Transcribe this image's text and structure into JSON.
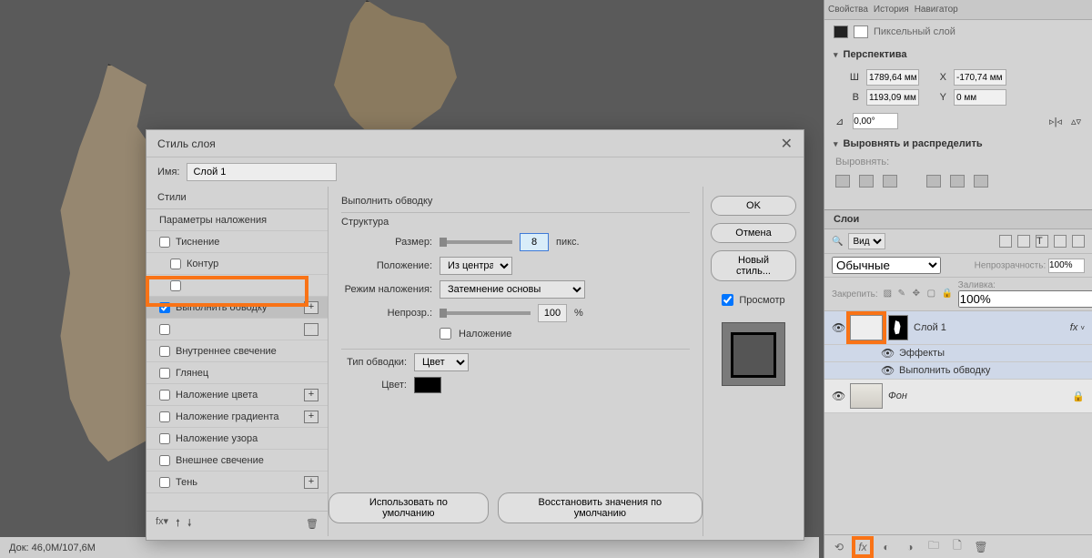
{
  "status_bar": {
    "doc_size": "Док: 46,0M/107,6M"
  },
  "dialog": {
    "title": "Стиль слоя",
    "name_label": "Имя:",
    "name_value": "Слой 1",
    "styles_header": "Стили",
    "styles_params": "Параметры наложения",
    "style_items": [
      {
        "label": "Тиснение",
        "checked": false,
        "plus": false,
        "indent": false
      },
      {
        "label": "Контур",
        "checked": false,
        "plus": false,
        "indent": true
      },
      {
        "label": "",
        "checked": false,
        "plus": false,
        "indent": true,
        "hidden": true
      },
      {
        "label": "Выполнить обводку",
        "checked": true,
        "plus": true,
        "indent": false,
        "selected": true
      },
      {
        "label": "",
        "checked": false,
        "plus": true,
        "indent": false,
        "hidden": true
      },
      {
        "label": "Внутреннее свечение",
        "checked": false,
        "plus": false,
        "indent": false
      },
      {
        "label": "Глянец",
        "checked": false,
        "plus": false,
        "indent": false
      },
      {
        "label": "Наложение цвета",
        "checked": false,
        "plus": true,
        "indent": false
      },
      {
        "label": "Наложение градиента",
        "checked": false,
        "plus": true,
        "indent": false
      },
      {
        "label": "Наложение узора",
        "checked": false,
        "plus": false,
        "indent": false
      },
      {
        "label": "Внешнее свечение",
        "checked": false,
        "plus": false,
        "indent": false
      },
      {
        "label": "Тень",
        "checked": false,
        "plus": true,
        "indent": false
      }
    ],
    "fx": {
      "title": "Выполнить обводку",
      "structure": "Структура",
      "size_label": "Размер:",
      "size_value": "8",
      "size_unit": "пикс.",
      "position_label": "Положение:",
      "position_value": "Из центра",
      "blend_label": "Режим наложения:",
      "blend_value": "Затемнение основы",
      "opacity_label": "Непрозр.:",
      "opacity_value": "100",
      "opacity_unit": "%",
      "overprint_label": "Наложение",
      "fill_type_label": "Тип обводки:",
      "fill_type_value": "Цвет",
      "color_label": "Цвет:"
    },
    "btn_default": "Использовать по умолчанию",
    "btn_reset": "Восстановить значения по умолчанию",
    "btn_ok": "OK",
    "btn_cancel": "Отмена",
    "btn_newstyle": "Новый стиль...",
    "preview_label": "Просмотр"
  },
  "panel": {
    "layer_type": "Пиксельный слой",
    "perspective": "Перспектива",
    "W_label": "Ш",
    "W_val": "1789,64 мм",
    "H_label": "В",
    "H_val": "1193,09 мм",
    "X_label": "X",
    "X_val": "-170,74 мм",
    "Y_label": "Y",
    "Y_val": "0 мм",
    "angle_val": "0,00°",
    "align_header": "Выровнять и распределить",
    "align_sub": "Выровнять:",
    "layers_tab": "Слои",
    "filter_kind": "Вид",
    "blend_mode": "Обычные",
    "opacity_label": "Непрозрачность:",
    "opacity_val": "100%",
    "lock_label": "Закрепить:",
    "fill_label": "Заливка:",
    "fill_val": "100%",
    "layer1": "Слой 1",
    "effects": "Эффекты",
    "effect_stroke": "Выполнить обводку",
    "bg_layer": "Фон",
    "fx_short": "fx"
  }
}
